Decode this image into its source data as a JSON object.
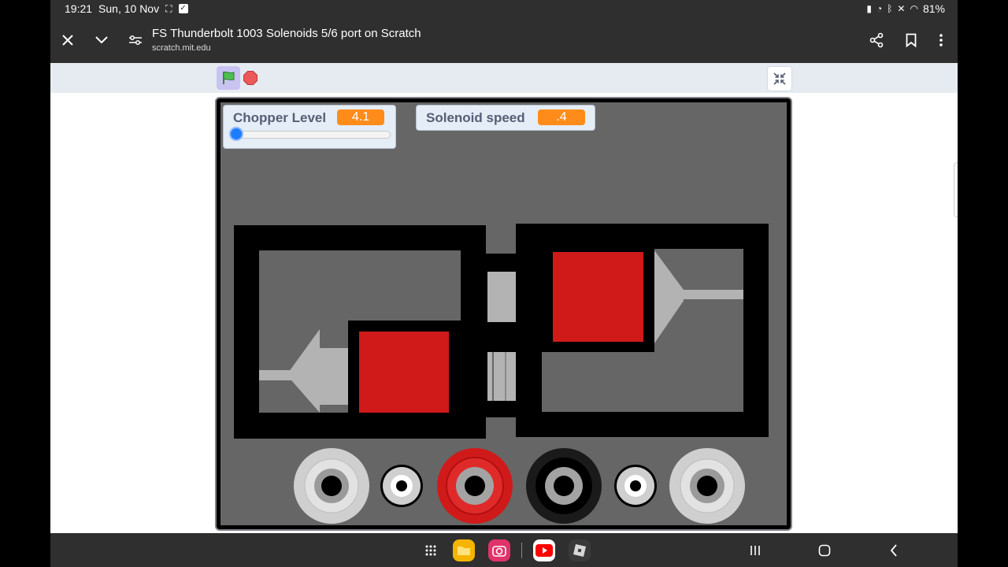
{
  "status_bar": {
    "time": "19:21",
    "date": "Sun, 10 Nov",
    "battery": "81%",
    "icons": [
      "screenshot-icon",
      "checkbox-icon",
      "battery-saver-icon",
      "alarm-icon",
      "bluetooth-icon",
      "mute-icon",
      "wifi-icon"
    ]
  },
  "browser": {
    "page_title": "FS Thunderbolt 1003 Solenoids 5/6 port on Scratch",
    "url": "scratch.mit.edu",
    "icons": [
      "close-icon",
      "chevron-down-icon",
      "site-settings-icon",
      "share-icon",
      "bookmark-icon",
      "more-icon"
    ]
  },
  "player": {
    "icons": [
      "green-flag-icon",
      "stop-icon",
      "exit-fullscreen-icon"
    ]
  },
  "monitors": [
    {
      "label": "Chopper Level",
      "value": "4.1",
      "slider_fraction": 0.0
    },
    {
      "label": "Solenoid speed",
      "value": ".4"
    }
  ],
  "colors": {
    "stage_bg": "#666666",
    "block_red": "#d01a1a",
    "light_gray": "#b3b3b3",
    "monitor_orange": "#ff8c1a",
    "slider_blue": "#1e7dff"
  },
  "nav_bar": {
    "apps": [
      "app-drawer-icon",
      "files-app-icon",
      "camera-app-icon",
      "youtube-app-icon",
      "roblox-app-icon"
    ],
    "buttons": [
      "recents-button",
      "home-button",
      "back-button"
    ]
  }
}
